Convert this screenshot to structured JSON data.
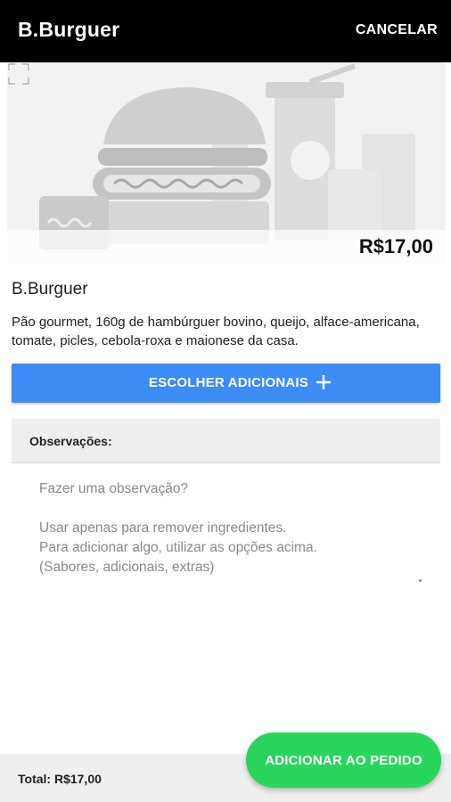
{
  "appbar": {
    "title": "B.Burguer",
    "cancel_label": "CANCELAR"
  },
  "hero": {
    "price": "R$17,00",
    "expand_icon": "expand-icon",
    "image": "burger-combo-illustration"
  },
  "product": {
    "name": "B.Burguer",
    "description": "Pão gourmet, 160g de hambúrguer bovino, queijo, alface-americana, tomate, picles, cebola-roxa e maionese da casa."
  },
  "choose_button": {
    "label": "ESCOLHER ADICIONAIS",
    "icon": "plus-icon",
    "color": "#3d8bf5"
  },
  "observations": {
    "label": "Observações:",
    "placeholder": "Fazer uma observação?\n\nUsar apenas para remover ingredientes.\nPara adicionar algo, utilizar as opções acima.\n(Sabores, adicionais, extras)"
  },
  "footer": {
    "total": "Total: R$17,00"
  },
  "add_button": {
    "label": "ADICIONAR AO PEDIDO",
    "color": "#28d65c"
  }
}
